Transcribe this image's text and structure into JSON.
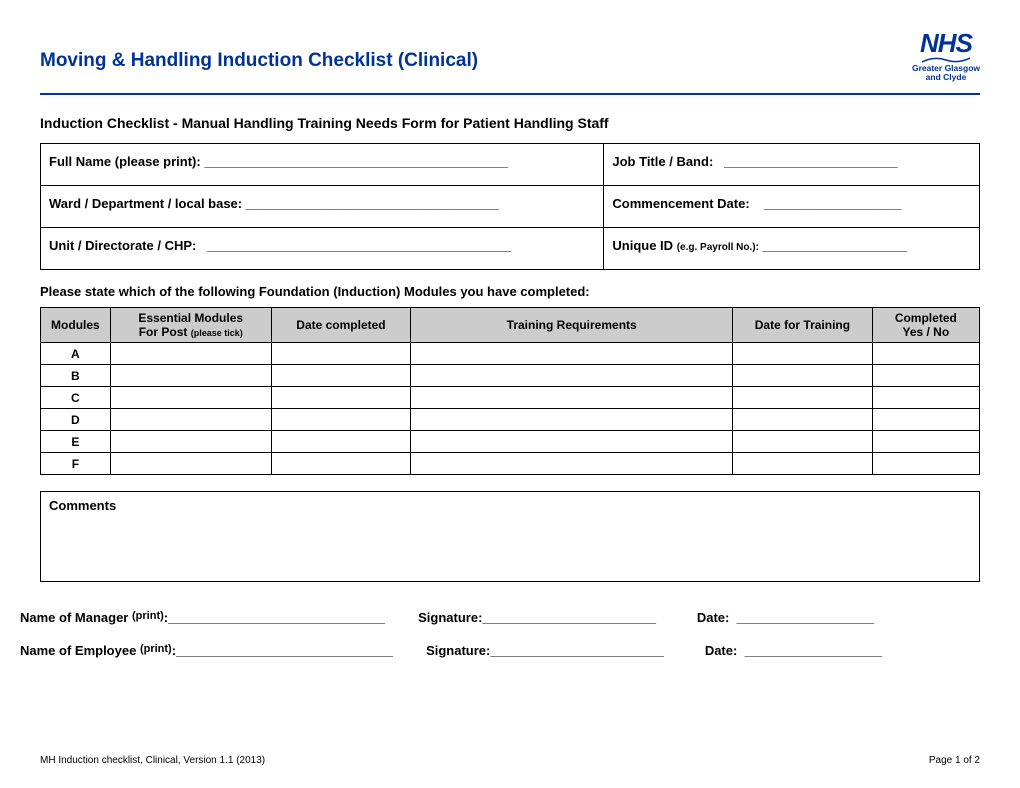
{
  "header": {
    "title": "Moving & Handling Induction Checklist (Clinical)",
    "logo_main": "NHS",
    "logo_sub1": "Greater Glasgow",
    "logo_sub2": "and Clyde"
  },
  "section_subtitle": "Induction Checklist - Manual Handling Training Needs Form for Patient Handling Staff",
  "details": {
    "full_name_label": "Full Name (please print):",
    "job_title_label": "Job Title / Band:",
    "ward_label": "Ward / Department / local base:",
    "commencement_label": "Commencement Date:",
    "unit_label": "Unit / Directorate / CHP:",
    "unique_id_label": "Unique ID",
    "unique_id_paren": "(e.g. Payroll No.):",
    "full_name_line": "__________________________________________",
    "job_title_line": "________________________",
    "ward_line": "___________________________________",
    "commencement_line": "___________________",
    "unit_line": "__________________________________________",
    "unique_id_line": "____________________"
  },
  "instructions": "Please state which of the following Foundation (Induction) Modules you have completed:",
  "modules_table": {
    "headers": {
      "modules": "Modules",
      "essential_line1": "Essential Modules",
      "essential_line2": "For Post",
      "essential_paren": "(please tick)",
      "date_completed": "Date completed",
      "training_req": "Training Requirements",
      "date_for_training": "Date for Training",
      "completed_line1": "Completed",
      "completed_line2": "Yes / No"
    },
    "rows": [
      "A",
      "B",
      "C",
      "D",
      "E",
      "F"
    ]
  },
  "comments_label": "Comments",
  "signatures": {
    "manager_label": "Name of Manager",
    "employee_label": "Name of Employee",
    "print_paren": "(print)",
    "signature_label": "Signature:",
    "date_label": "Date:",
    "name_line": "______________________________",
    "sig_line": "________________________",
    "date_line": "___________________"
  },
  "footer": {
    "left": "MH Induction checklist, Clinical, Version 1.1 (2013)",
    "right": "Page 1 of 2"
  }
}
